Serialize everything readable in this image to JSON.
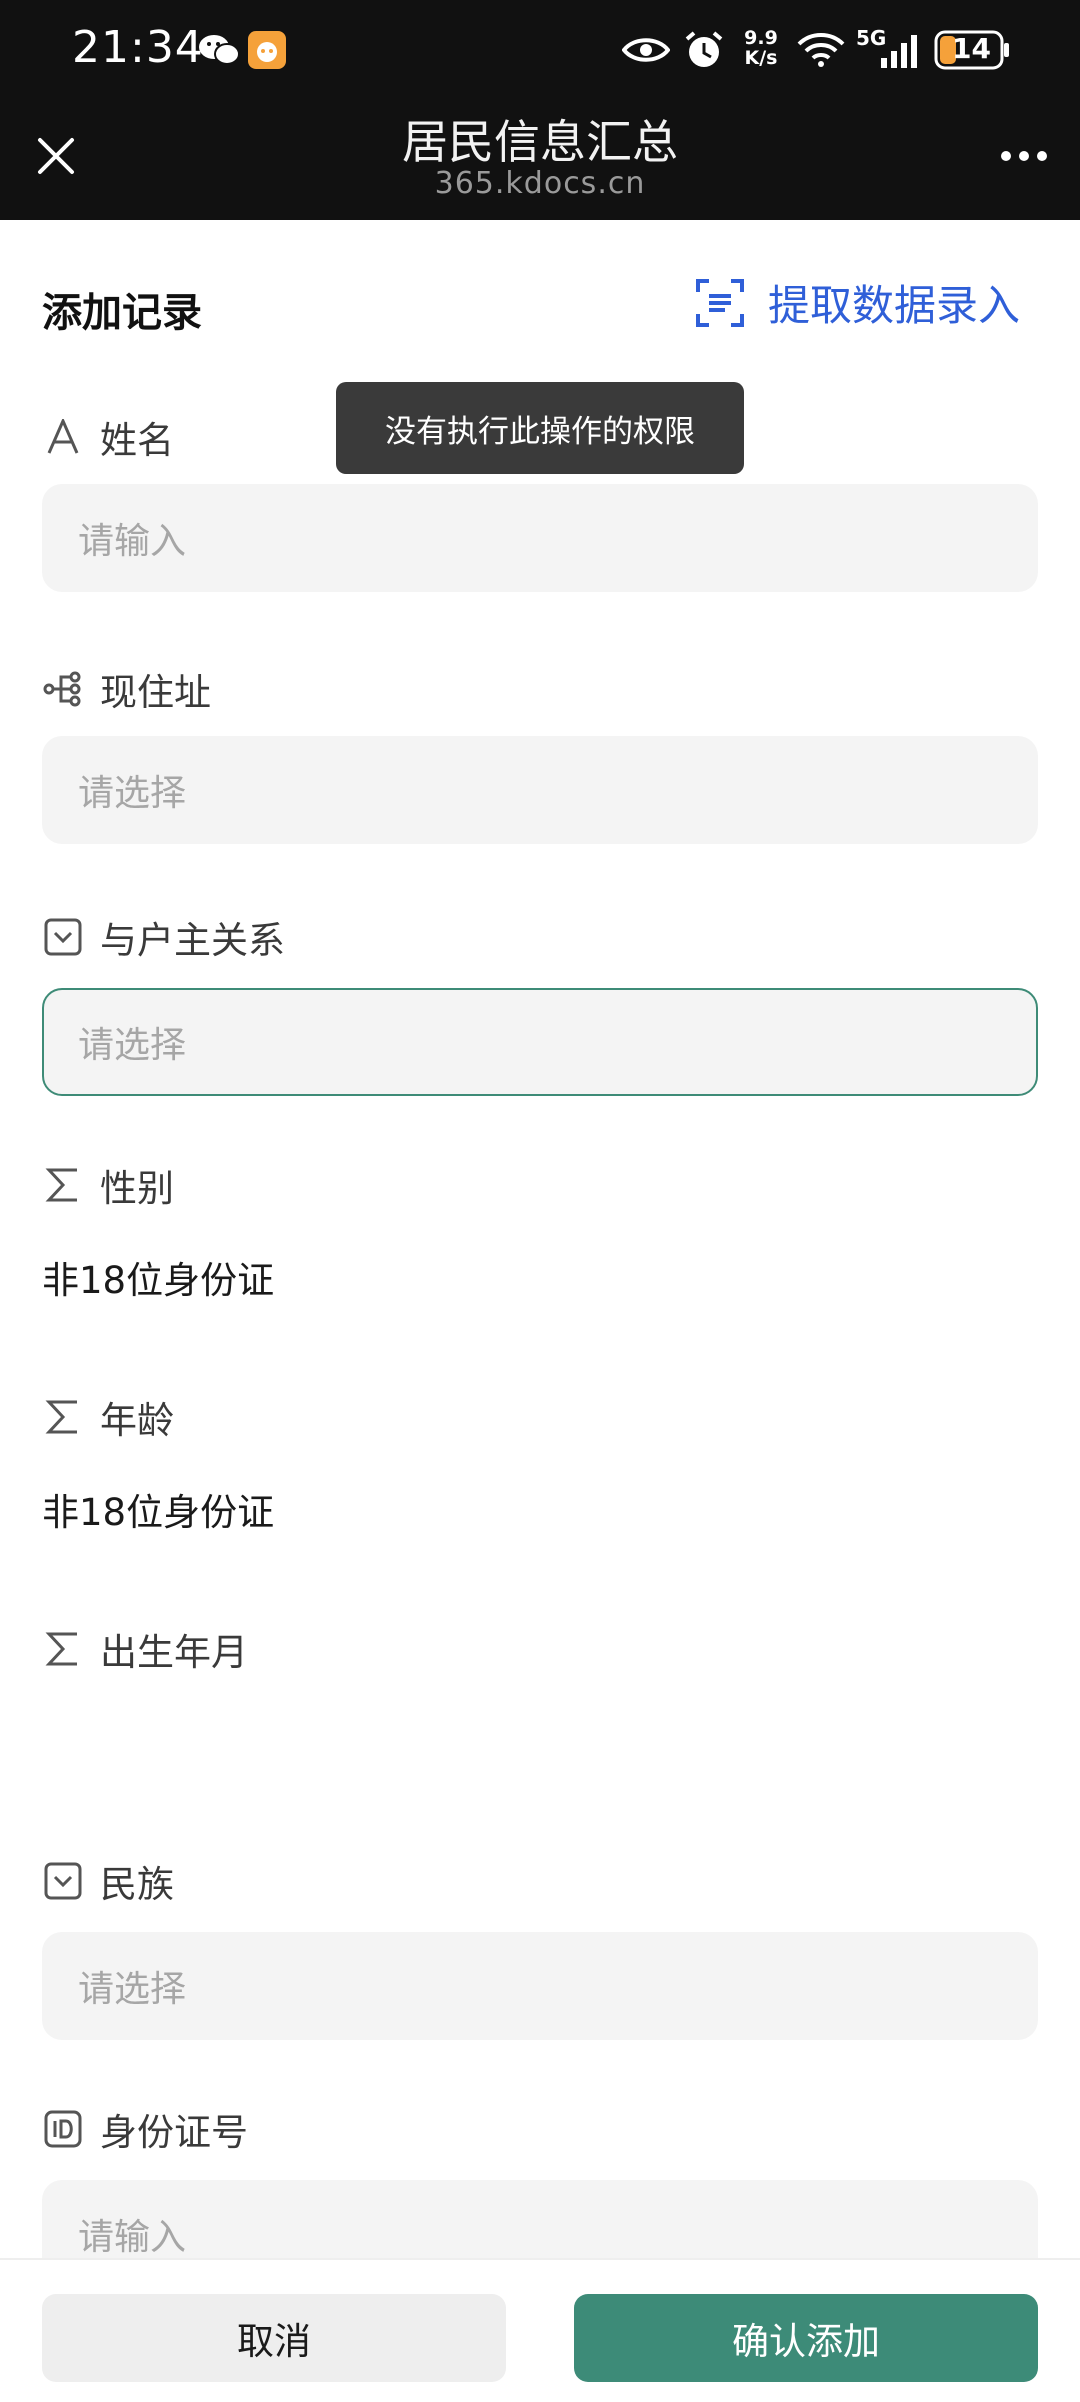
{
  "status_bar": {
    "time": "21:34",
    "net_speed_top": "9.9",
    "net_speed_bottom": "K/s",
    "signal_type": "5G",
    "battery": "14"
  },
  "header": {
    "title": "居民信息汇总",
    "url": "365.kdocs.cn"
  },
  "form": {
    "title": "添加记录",
    "extract_label": "提取数据录入",
    "toast": "没有执行此操作的权限",
    "fields": [
      {
        "label": "姓名",
        "icon": "text-type-icon",
        "placeholder": "请输入"
      },
      {
        "label": "现住址",
        "icon": "hierarchy-icon",
        "placeholder": "请选择"
      },
      {
        "label": "与户主关系",
        "icon": "dropdown-select-icon",
        "placeholder": "请选择"
      },
      {
        "label": "性别",
        "icon": "formula-sigma-icon",
        "value": "非18位身份证"
      },
      {
        "label": "年龄",
        "icon": "formula-sigma-icon",
        "value": "非18位身份证"
      },
      {
        "label": "出生年月",
        "icon": "formula-sigma-icon",
        "value": ""
      },
      {
        "label": "民族",
        "icon": "dropdown-select-icon",
        "placeholder": "请选择"
      },
      {
        "label": "身份证号",
        "icon": "id-card-icon",
        "placeholder": "请输入"
      }
    ]
  },
  "footer": {
    "cancel_label": "取消",
    "confirm_label": "确认添加"
  },
  "colors": {
    "accent": "#3d8b78",
    "link": "#2f5fd8",
    "header_bg": "#111111"
  }
}
